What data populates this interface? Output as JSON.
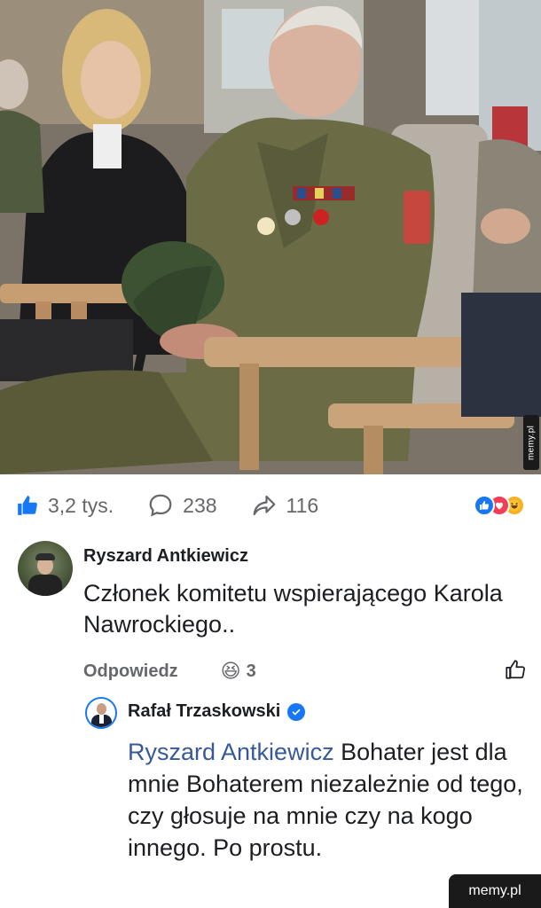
{
  "post": {
    "photo_description_icon": "photo",
    "stats": {
      "likes": "3,2 tys.",
      "comments": "238",
      "shares": "116"
    },
    "reaction_icons": [
      "like-icon",
      "love-icon",
      "haha-icon"
    ]
  },
  "comment": {
    "author": "Ryszard Antkiewicz",
    "text": "Członek komitetu wspierającego Karola Nawrockiego..",
    "reply_label": "Odpowiedz",
    "reaction_emoji": "😆",
    "reaction_count": "3"
  },
  "reply": {
    "author": "Rafał Trzaskowski",
    "mention": "Ryszard Antkiewicz",
    "text": " Bohater jest dla mnie Bohaterem niezależnie od tego, czy głosuje na mnie czy na kogo innego. Po prostu."
  },
  "watermarks": {
    "side": "memy.pl",
    "bottom": "memy.pl"
  },
  "colors": {
    "accent": "#1877f2",
    "mention": "#385898",
    "muted": "#65676b"
  }
}
